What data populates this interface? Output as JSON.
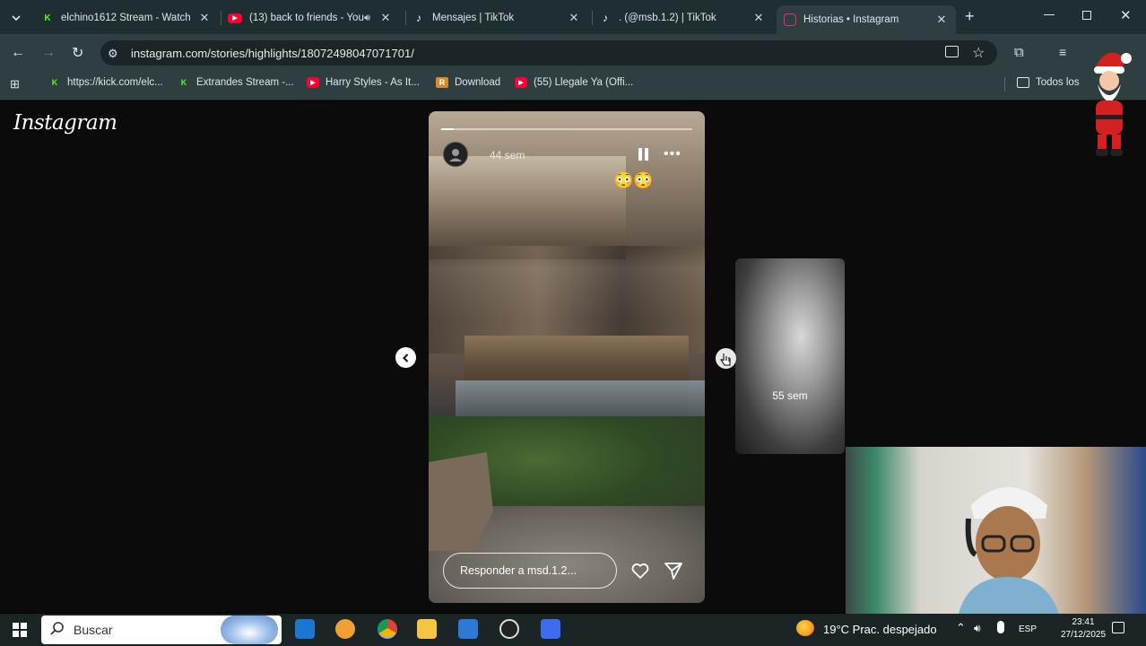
{
  "browser": {
    "tabs": [
      {
        "title": "elchino1612 Stream - Watch",
        "favicon": "kick-icon",
        "color": "#53fc18"
      },
      {
        "title": "(13) back to friends - You",
        "favicon": "youtube-icon",
        "color": "#ff0033"
      },
      {
        "title": "Mensajes | TikTok",
        "favicon": "tiktok-icon",
        "color": "#ffffff"
      },
      {
        "title": ". (@msb.1.2) | TikTok",
        "favicon": "tiktok-icon",
        "color": "#ffffff"
      },
      {
        "title": "Historias • Instagram",
        "favicon": "instagram-icon",
        "color": "#e1306c"
      }
    ],
    "url": "instagram.com/stories/highlights/18072498047071701/",
    "bookmarks": [
      {
        "label": "https://kick.com/elc...",
        "icon": "kick-icon"
      },
      {
        "label": "Extrandes Stream -...",
        "icon": "kick-icon"
      },
      {
        "label": "Harry Styles - As It...",
        "icon": "youtube-icon"
      },
      {
        "label": "Download",
        "icon": "download-icon"
      },
      {
        "label": "(55) Llegale Ya (Offi...",
        "icon": "youtube-icon"
      }
    ],
    "all_bookmarks_label": "Todos los"
  },
  "instagram": {
    "logo": "Instagram",
    "story": {
      "time_ago": "44 sem",
      "progress": 0.05,
      "segments": 1,
      "emoji": "😳😳",
      "reply_placeholder": "Responder a msd.1.2..."
    },
    "next_preview": {
      "time_ago": "55 sem"
    }
  },
  "taskbar": {
    "search_placeholder": "Buscar",
    "weather": "19°C  Prac. despejado",
    "language": "ESP",
    "time": "23:41",
    "date": "27/12/2025"
  },
  "colors": {
    "tabstrip": "#1f2e30",
    "toolbar": "#2f3f41",
    "page": "#0b0b0b"
  }
}
